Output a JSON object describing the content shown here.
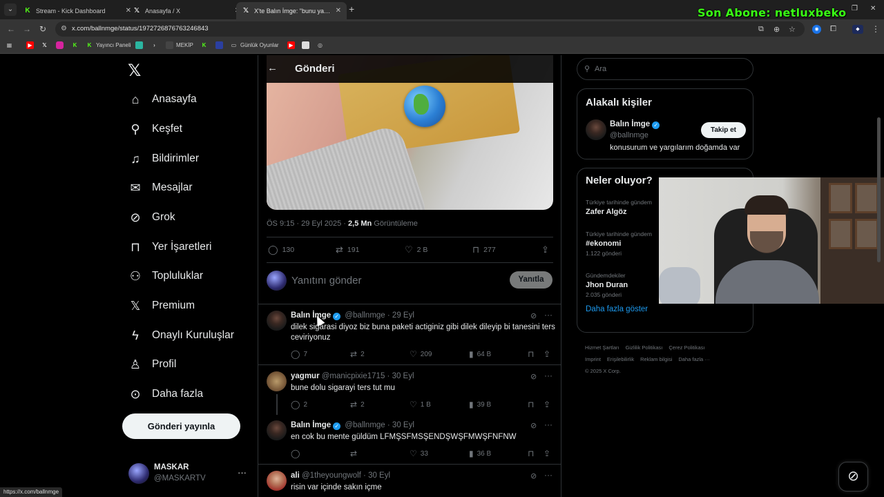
{
  "browser": {
    "tabs": [
      {
        "title": "Stream - Kick Dashboard",
        "favicon": "kick-icon"
      },
      {
        "title": "Anasayfa / X",
        "favicon": "x-icon"
      },
      {
        "title": "X'te Balın İmge: \"bunu yapan te",
        "favicon": "x-icon"
      }
    ],
    "url": "x.com/ballnmge/status/1972726876763246843",
    "bookmarks": [
      "Yayıncı Paneli",
      "MEKİP",
      "Günlük Oyunlar"
    ],
    "status_url": "https://x.com/ballnmge"
  },
  "overlay": {
    "sub_text": "Son Abone: netluxbeko",
    "sub_color": "#39ff14"
  },
  "nav": {
    "items": [
      {
        "label": "Anasayfa",
        "icon": "home-icon"
      },
      {
        "label": "Keşfet",
        "icon": "search-icon"
      },
      {
        "label": "Bildirimler",
        "icon": "bell-icon"
      },
      {
        "label": "Mesajlar",
        "icon": "mail-icon"
      },
      {
        "label": "Grok",
        "icon": "grok-icon"
      },
      {
        "label": "Yer İşaretleri",
        "icon": "bookmark-icon"
      },
      {
        "label": "Topluluklar",
        "icon": "people-icon"
      },
      {
        "label": "Premium",
        "icon": "x-icon"
      },
      {
        "label": "Onaylı Kuruluşlar",
        "icon": "lightning-icon"
      },
      {
        "label": "Profil",
        "icon": "person-icon"
      },
      {
        "label": "Daha fazla",
        "icon": "more-circle-icon"
      }
    ],
    "post_button": "Gönderi yayınla",
    "account": {
      "name": "MASKAR",
      "handle": "@MASKARTV"
    }
  },
  "post": {
    "header_title": "Gönderi",
    "meta_time": "ÖS 9:15 · 29 Eyl 2025 · ",
    "views": "2,5 Mn",
    "views_label": " Görüntüleme",
    "replies": "130",
    "reposts": "191",
    "likes": "2 B",
    "bookmarks": "277",
    "reply_placeholder": "Yanıtını gönder",
    "reply_button": "Yanıtla"
  },
  "replies": [
    {
      "name": "Balın İmge",
      "verified": true,
      "handle": "@ballnmge",
      "date": "· 29 Eyl",
      "text": "dilek sigarasi diyoz biz buna paketi actiginiz gibi dilek dileyip bi tanesini ters ceviriyonuz",
      "replies": "7",
      "reposts": "2",
      "likes": "209",
      "views": "64 B"
    },
    {
      "name": "yagmur",
      "verified": false,
      "handle": "@manicpixie1715",
      "date": "· 30 Eyl",
      "text": "bune dolu sigarayi ters tut mu",
      "replies": "2",
      "reposts": "2",
      "likes": "1 B",
      "views": "39 B"
    },
    {
      "name": "Balın İmge",
      "verified": true,
      "handle": "@ballnmge",
      "date": "· 30 Eyl",
      "text": "en cok bu mente güldüm LFMŞSFMSŞENDŞWŞFMWŞFNFNW",
      "replies": "",
      "reposts": "",
      "likes": "33",
      "views": "36 B"
    },
    {
      "name": "ali",
      "verified": false,
      "handle": "@1theyoungwolf",
      "date": "· 30 Eyl",
      "text": "risin var içinde sakın içme",
      "replies": "",
      "reposts": "",
      "likes": "",
      "views": ""
    }
  ],
  "sidebar": {
    "search_placeholder": "Ara",
    "related_title": "Alakalı kişiler",
    "related": {
      "name": "Balın İmge",
      "handle": "@ballnmge",
      "bio": "konusurum ve yargılarım doğamda var",
      "follow": "Takip et"
    },
    "trends_title": "Neler oluyor?",
    "trends": [
      {
        "context": "Türkiye tarihinde gündem",
        "name": "Zafer Algöz",
        "count": ""
      },
      {
        "context": "Türkiye tarihinde gündem",
        "name": "#ekonomi",
        "count": "1.122 gönderi"
      },
      {
        "context": "Gündemdekiler",
        "name": "Jhon Duran",
        "count": "2.035 gönderi"
      }
    ],
    "show_more": "Daha fazla göster",
    "footer_links": [
      "Hizmet Şartları",
      "Gizlilik Politikası",
      "Çerez Politikası",
      "Imprint",
      "Erişilebilirlik",
      "Reklam bilgisi",
      "Daha fazla ···"
    ],
    "copyright": "© 2025 X Corp."
  },
  "colors": {
    "accent": "#1d9bf0",
    "background": "#000000",
    "muted": "#71767b"
  }
}
